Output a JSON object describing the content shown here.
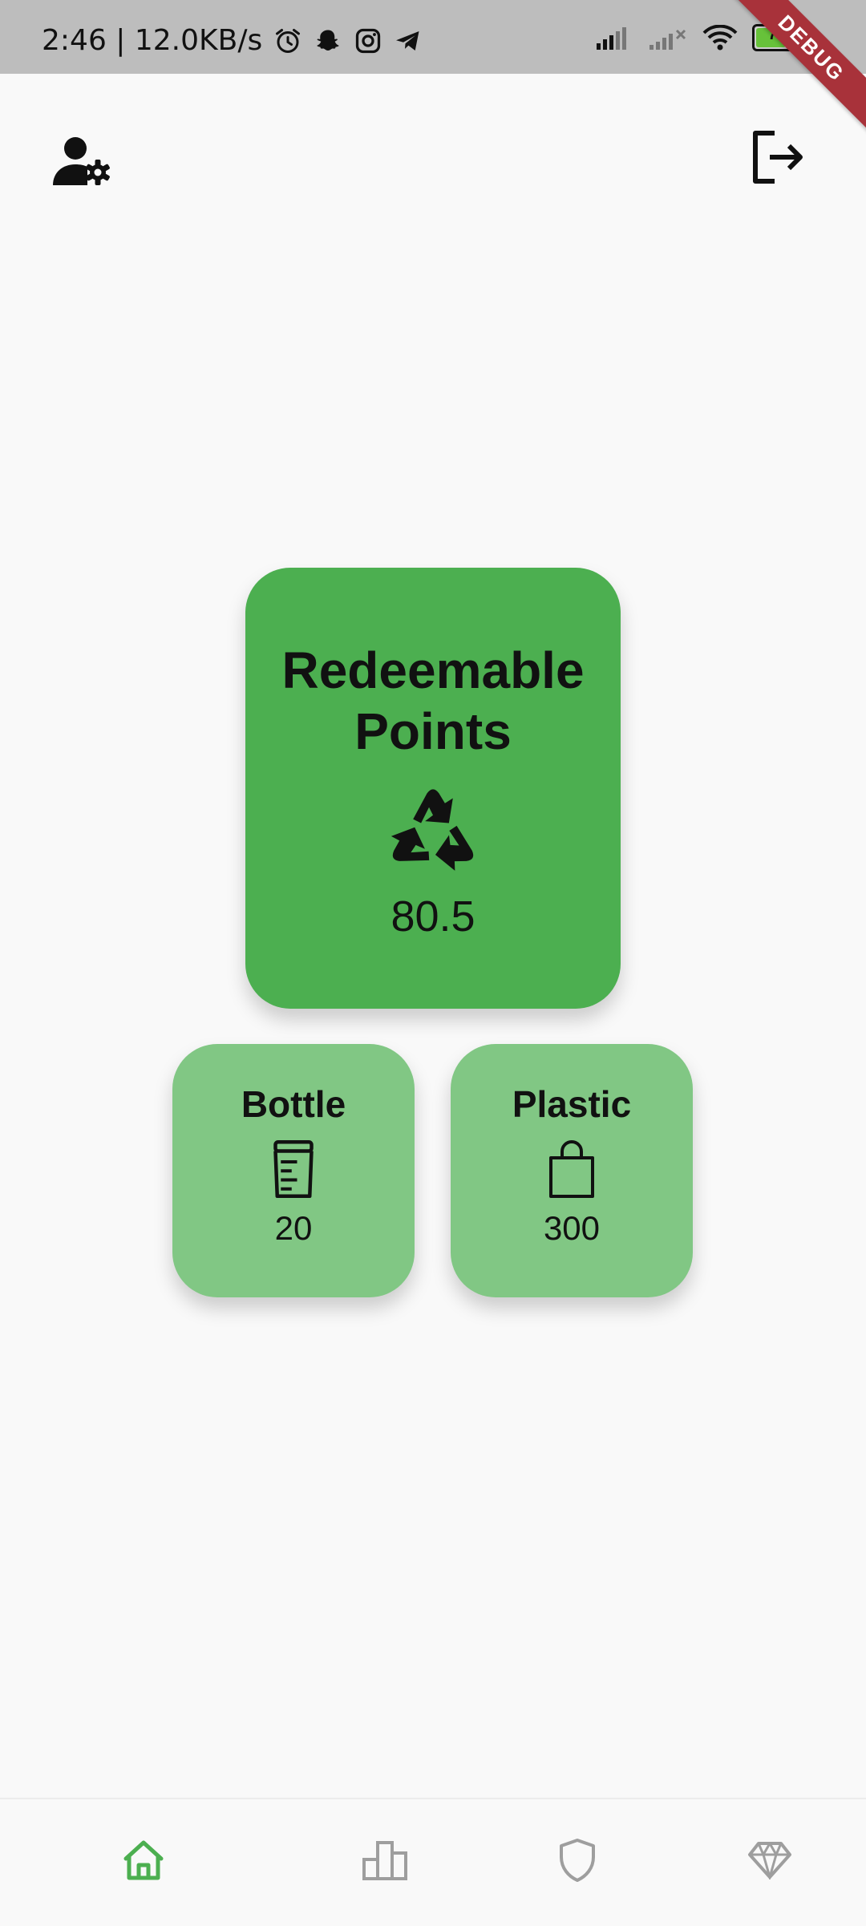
{
  "status_bar": {
    "time_speed": "2:46 | 12.0KB/s",
    "battery_level": "73",
    "battery_fraction": 0.73,
    "icons": [
      "alarm-icon",
      "snapchat-icon",
      "instagram-icon",
      "telegram-icon",
      "signal-icon",
      "signal-no-service-icon",
      "wifi-icon",
      "battery-icon"
    ]
  },
  "debug_banner": "DEBUG",
  "header": {
    "left_icon": "manage-account-icon",
    "right_icon": "logout-icon"
  },
  "points_card": {
    "title_line1": "Redeemable",
    "title_line2": "Points",
    "icon": "recycle-icon",
    "value": "80.5"
  },
  "bottle_card": {
    "title": "Bottle",
    "icon": "bottle-icon",
    "value": "20"
  },
  "plastic_card": {
    "title": "Plastic",
    "icon": "shopping-bag-icon",
    "value": "300"
  },
  "bottom_nav": {
    "active_color": "#4caf50",
    "inactive_color": "#9e9e9e",
    "items": [
      "home-icon",
      "leaderboard-icon",
      "shield-icon",
      "diamond-icon"
    ]
  },
  "colors": {
    "primary_card": "#4caf50",
    "secondary_card": "#81c784",
    "background": "#f9f9f9"
  }
}
